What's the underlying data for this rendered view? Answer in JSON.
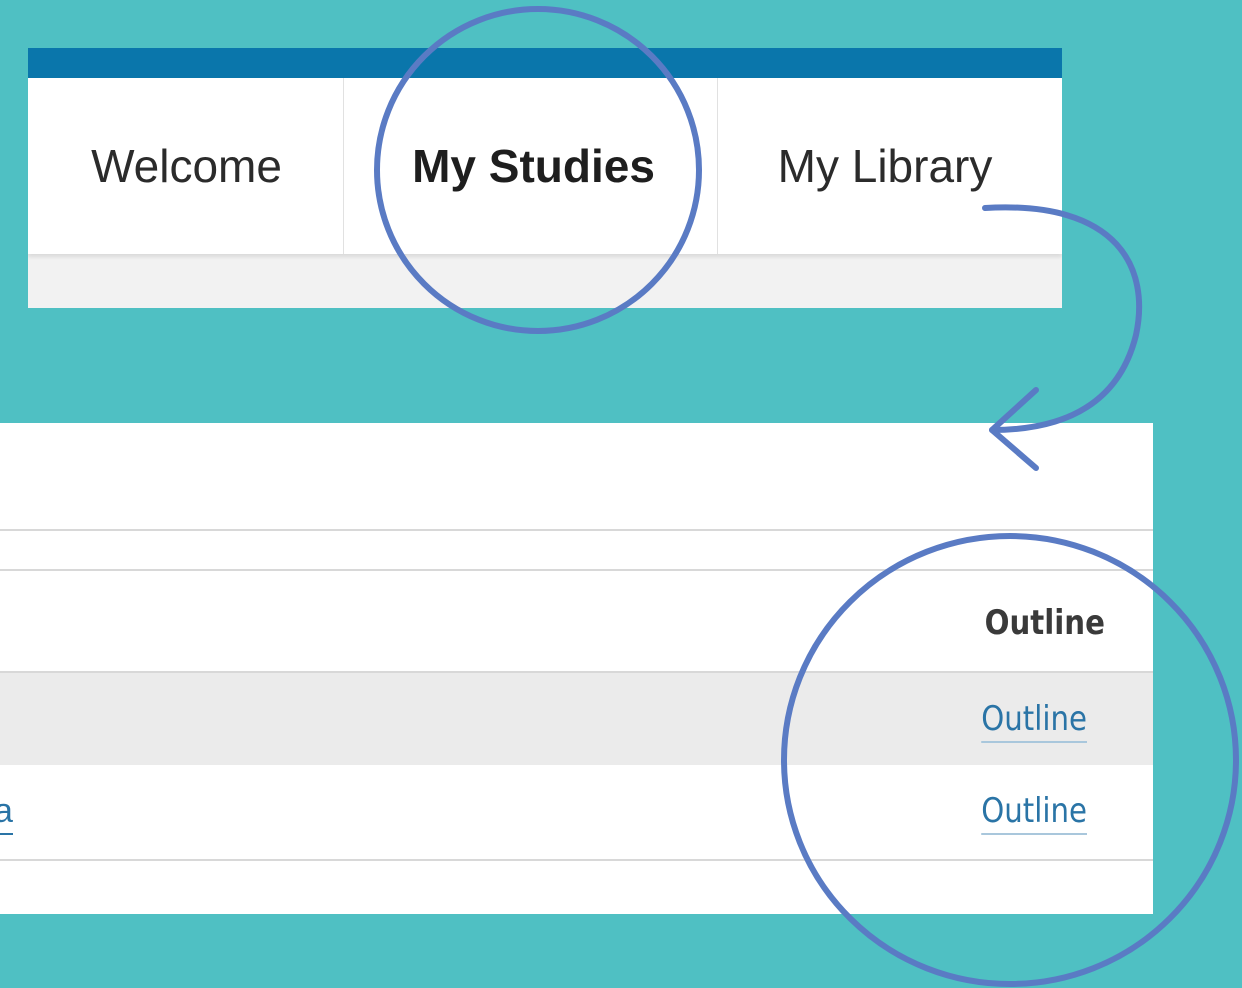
{
  "nav": {
    "tabs": [
      {
        "label": "Welcome"
      },
      {
        "label": "My Studies",
        "active": true
      },
      {
        "label": "My Library"
      }
    ],
    "topbar_color": "#0a76ab"
  },
  "table": {
    "header": {
      "outline_label": "Outline"
    },
    "rows": [
      {
        "left_link_text": "",
        "outline_link": "Outline"
      },
      {
        "left_link_text": "a",
        "outline_link": "Outline"
      }
    ]
  },
  "annotations": {
    "color": "#5a7bc4",
    "items": [
      "circle-my-studies",
      "curved-arrow",
      "circle-outline-column"
    ]
  },
  "colors": {
    "background": "#4fc0c3",
    "link": "#2a74a6",
    "row_alt": "#ebebeb"
  }
}
